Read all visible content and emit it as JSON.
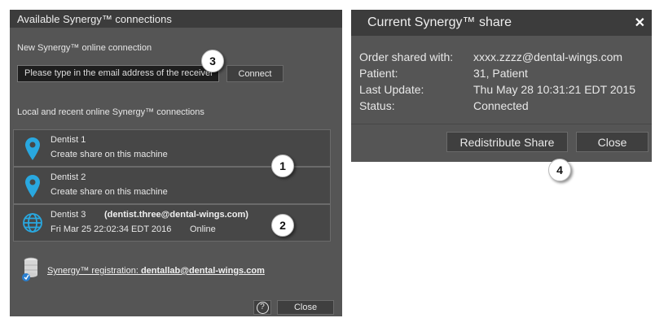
{
  "left_dialog": {
    "title": "Available Synergy™ connections",
    "new_connection_label": "New Synergy™ online connection",
    "email_placeholder": "Please type in the email address of the receiver",
    "connect_label": "Connect",
    "recent_label": "Local and recent online Synergy™ connections",
    "items": [
      {
        "name": "Dentist 1",
        "sub": "Create share on this machine",
        "icon": "location-pin-icon"
      },
      {
        "name": "Dentist 2",
        "sub": "Create share on this machine",
        "icon": "location-pin-icon"
      },
      {
        "name": "Dentist 3",
        "email": "(dentist.three@dental-wings.com)",
        "date": "Fri Mar 25 22:02:34 EDT 2016",
        "status": "Online",
        "icon": "globe-icon"
      }
    ],
    "registration_prefix": "Synergy™ registration: ",
    "registration_email": "dentallab@dental-wings.com",
    "help_label": "?",
    "close_label": "Close"
  },
  "right_dialog": {
    "title": "Current Synergy™ share",
    "close_x": "✕",
    "rows": [
      {
        "key": "Order shared with:",
        "value": "xxxx.zzzz@dental-wings.com"
      },
      {
        "key": "Patient:",
        "value": "31, Patient"
      },
      {
        "key": "Last Update:",
        "value": "Thu May 28 10:31:21 EDT 2015"
      },
      {
        "key": "Status:",
        "value": "Connected"
      }
    ],
    "redistribute_label": "Redistribute Share",
    "close_label": "Close"
  },
  "callouts": [
    "3",
    "1",
    "2",
    "4"
  ],
  "colors": {
    "panel": "#555555",
    "titlebar": "#3c3c3c",
    "pin": "#29a8e0"
  }
}
